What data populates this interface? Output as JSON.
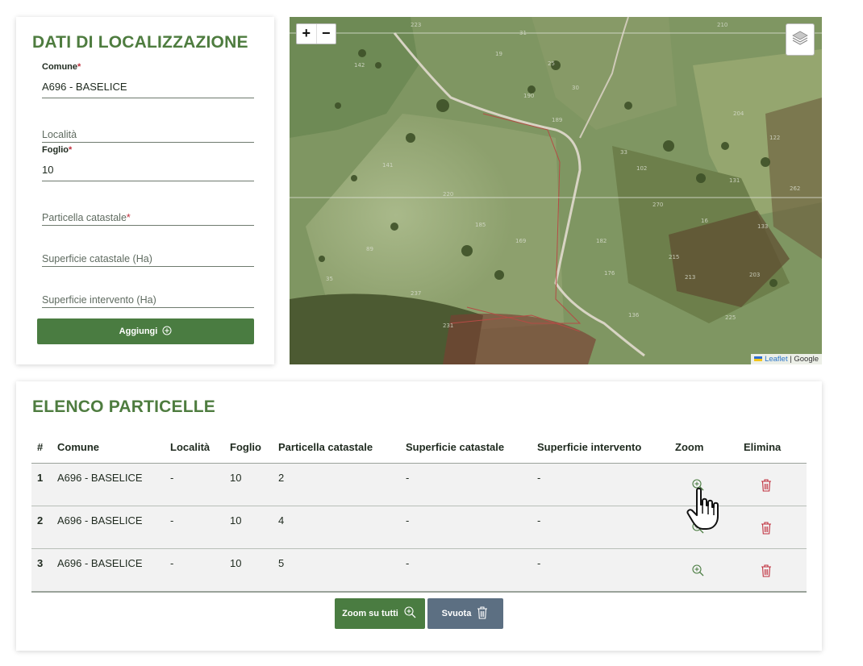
{
  "form": {
    "title": "DATI DI LOCALIZZAZIONE",
    "comune": {
      "label": "Comune",
      "required_mark": "*",
      "value": "A696 - BASELICE"
    },
    "localita": {
      "placeholder": "Località"
    },
    "foglio": {
      "label": "Foglio",
      "required_mark": "*",
      "value": "10"
    },
    "particella": {
      "placeholder": "Particella catastale",
      "required_mark": "*"
    },
    "sup_catastale": {
      "placeholder": "Superficie catastale (Ha)"
    },
    "sup_intervento": {
      "placeholder": "Superficie intervento (Ha)"
    },
    "add_button": "Aggiungi",
    "add_icon": "plus-circle-icon"
  },
  "map": {
    "zoom_in": "+",
    "zoom_out": "−",
    "layers_icon": "layers-icon",
    "attribution_link": "Leaflet",
    "attribution_sep": " | ",
    "attribution_source": "Google",
    "parcel_labels": [
      "223",
      "142",
      "31",
      "19",
      "25",
      "30",
      "190",
      "189",
      "210",
      "102",
      "204",
      "122",
      "141",
      "33",
      "220",
      "131",
      "262",
      "169",
      "182",
      "270",
      "215",
      "213",
      "133",
      "176",
      "136",
      "35",
      "237",
      "231",
      "225",
      "203",
      "89",
      "185",
      "16"
    ]
  },
  "table": {
    "title": "ELENCO PARTICELLE",
    "headers": [
      "#",
      "Comune",
      "Località",
      "Foglio",
      "Particella catastale",
      "Superficie catastale",
      "Superficie intervento",
      "Zoom",
      "Elimina"
    ],
    "rows": [
      {
        "num": "1",
        "comune": "A696 - BASELICE",
        "localita": "-",
        "foglio": "10",
        "particella": "2",
        "sup_cat": "-",
        "sup_int": "-"
      },
      {
        "num": "2",
        "comune": "A696 - BASELICE",
        "localita": "-",
        "foglio": "10",
        "particella": "4",
        "sup_cat": "-",
        "sup_int": "-"
      },
      {
        "num": "3",
        "comune": "A696 - BASELICE",
        "localita": "-",
        "foglio": "10",
        "particella": "5",
        "sup_cat": "-",
        "sup_int": "-"
      }
    ],
    "zoom_all_button": "Zoom su tutti",
    "empty_button": "Svuota"
  },
  "colors": {
    "accent_green": "#4a7c41",
    "title_green": "#4e7c3f",
    "danger_red": "#c0303e",
    "slate_button": "#5c6f82"
  }
}
